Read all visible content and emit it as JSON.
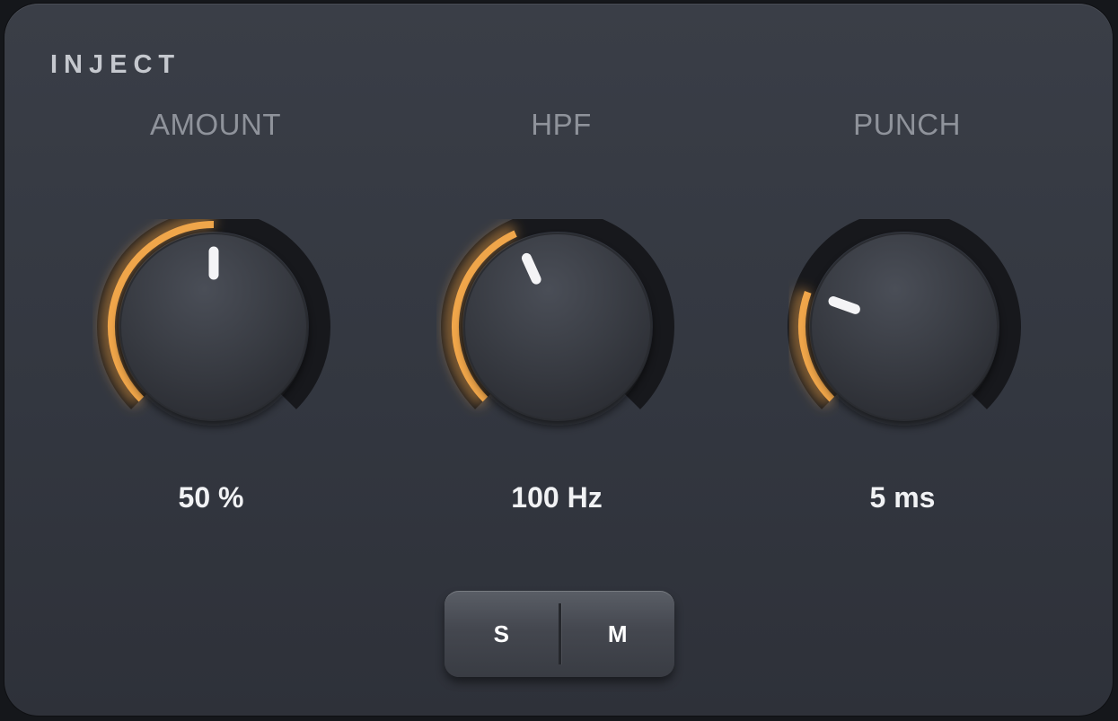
{
  "panel": {
    "title": "INJECT"
  },
  "colors": {
    "accent": "#f0a64a",
    "panel": "#363a42",
    "knob": "#3a3d44",
    "label": "#8f939b",
    "value": "#f1f2f4"
  },
  "knobs": [
    {
      "label": "AMOUNT",
      "value_text": "50 %",
      "fraction": 0.5
    },
    {
      "label": "HPF",
      "value_text": "100 Hz",
      "fraction": 0.41
    },
    {
      "label": "PUNCH",
      "value_text": "5 ms",
      "fraction": 0.24
    }
  ],
  "switch": {
    "left_label": "S",
    "right_label": "M"
  }
}
